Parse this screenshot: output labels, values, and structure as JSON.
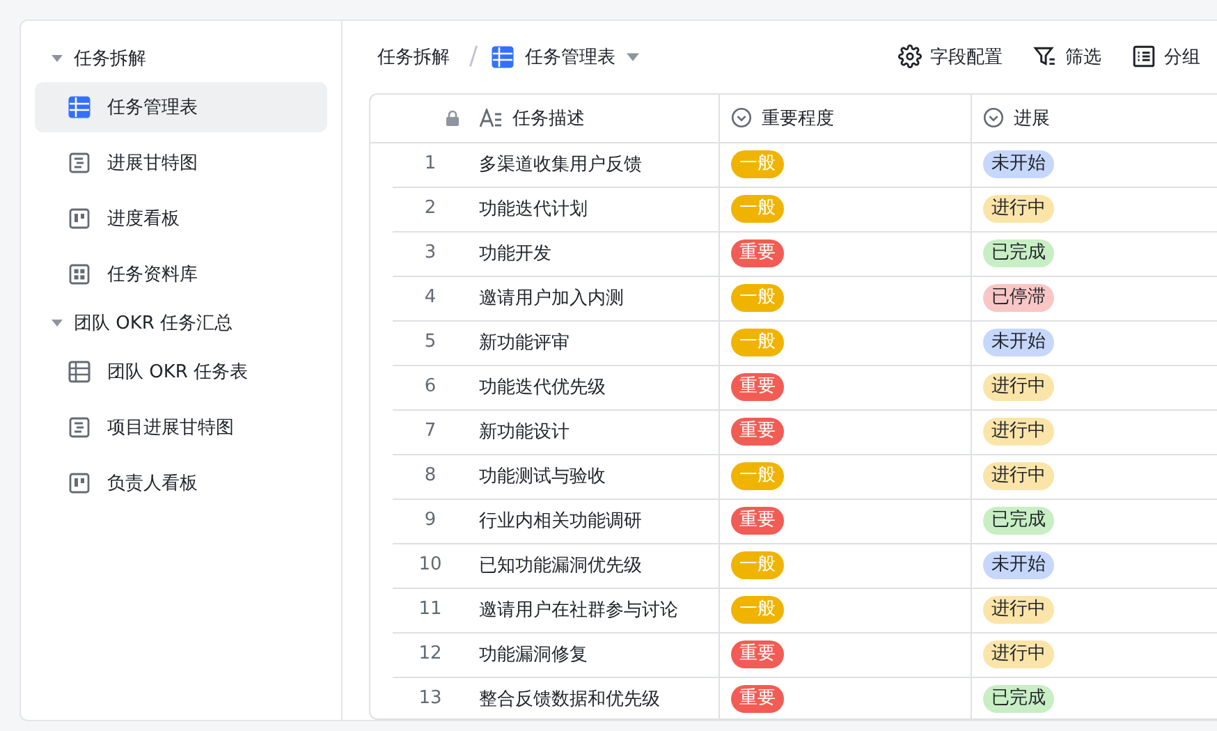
{
  "sidebar": {
    "groups": [
      {
        "label": "任务拆解",
        "expanded": true,
        "children": [
          {
            "label": "任务管理表",
            "kind": "grid",
            "selected": true
          },
          {
            "label": "进展甘特图",
            "kind": "gantt",
            "selected": false
          },
          {
            "label": "进度看板",
            "kind": "kanban",
            "selected": false
          },
          {
            "label": "任务资料库",
            "kind": "gallery",
            "selected": false
          }
        ]
      },
      {
        "label": "团队 OKR 任务汇总",
        "expanded": true,
        "children": [
          {
            "label": "团队 OKR 任务表",
            "kind": "grid",
            "selected": false
          },
          {
            "label": "项目进展甘特图",
            "kind": "gantt",
            "selected": false
          },
          {
            "label": "负责人看板",
            "kind": "kanban",
            "selected": false
          }
        ]
      }
    ]
  },
  "breadcrumb": {
    "parent": "任务拆解",
    "separator": "/",
    "current": "任务管理表"
  },
  "toolbar": [
    {
      "label": "字段配置",
      "kind": "settings"
    },
    {
      "label": "筛选",
      "kind": "filter"
    },
    {
      "label": "分组",
      "kind": "group"
    }
  ],
  "table": {
    "columns": [
      {
        "label": "任务描述",
        "kind": "text"
      },
      {
        "label": "重要程度",
        "kind": "select"
      },
      {
        "label": "进展",
        "kind": "select"
      }
    ],
    "rows": [
      {
        "index": "1",
        "task": "多渠道收集用户反馈",
        "importance": {
          "label": "一般",
          "color": "#f0b400"
        },
        "progress": {
          "label": "未开始",
          "color": "#c6d7fb"
        }
      },
      {
        "index": "2",
        "task": "功能迭代计划",
        "importance": {
          "label": "一般",
          "color": "#f0b400"
        },
        "progress": {
          "label": "进行中",
          "color": "#fbe4a8"
        }
      },
      {
        "index": "3",
        "task": "功能开发",
        "importance": {
          "label": "重要",
          "color": "#f25c54"
        },
        "progress": {
          "label": "已完成",
          "color": "#c8eec4"
        }
      },
      {
        "index": "4",
        "task": "邀请用户加入内测",
        "importance": {
          "label": "一般",
          "color": "#f0b400"
        },
        "progress": {
          "label": "已停滞",
          "color": "#f9c6c6"
        }
      },
      {
        "index": "5",
        "task": "新功能评审",
        "importance": {
          "label": "一般",
          "color": "#f0b400"
        },
        "progress": {
          "label": "未开始",
          "color": "#c6d7fb"
        }
      },
      {
        "index": "6",
        "task": "功能迭代优先级",
        "importance": {
          "label": "重要",
          "color": "#f25c54"
        },
        "progress": {
          "label": "进行中",
          "color": "#fbe4a8"
        }
      },
      {
        "index": "7",
        "task": "新功能设计",
        "importance": {
          "label": "重要",
          "color": "#f25c54"
        },
        "progress": {
          "label": "进行中",
          "color": "#fbe4a8"
        }
      },
      {
        "index": "8",
        "task": "功能测试与验收",
        "importance": {
          "label": "一般",
          "color": "#f0b400"
        },
        "progress": {
          "label": "进行中",
          "color": "#fbe4a8"
        }
      },
      {
        "index": "9",
        "task": "行业内相关功能调研",
        "importance": {
          "label": "重要",
          "color": "#f25c54"
        },
        "progress": {
          "label": "已完成",
          "color": "#c8eec4"
        }
      },
      {
        "index": "10",
        "task": "已知功能漏洞优先级",
        "importance": {
          "label": "一般",
          "color": "#f0b400"
        },
        "progress": {
          "label": "未开始",
          "color": "#c6d7fb"
        }
      },
      {
        "index": "11",
        "task": "邀请用户在社群参与讨论",
        "importance": {
          "label": "一般",
          "color": "#f0b400"
        },
        "progress": {
          "label": "进行中",
          "color": "#fbe4a8"
        }
      },
      {
        "index": "12",
        "task": "功能漏洞修复",
        "importance": {
          "label": "重要",
          "color": "#f25c54"
        },
        "progress": {
          "label": "进行中",
          "color": "#fbe4a8"
        }
      },
      {
        "index": "13",
        "task": "整合反馈数据和优先级",
        "importance": {
          "label": "重要",
          "color": "#f25c54"
        },
        "progress": {
          "label": "已完成",
          "color": "#c8eec4"
        }
      }
    ]
  }
}
